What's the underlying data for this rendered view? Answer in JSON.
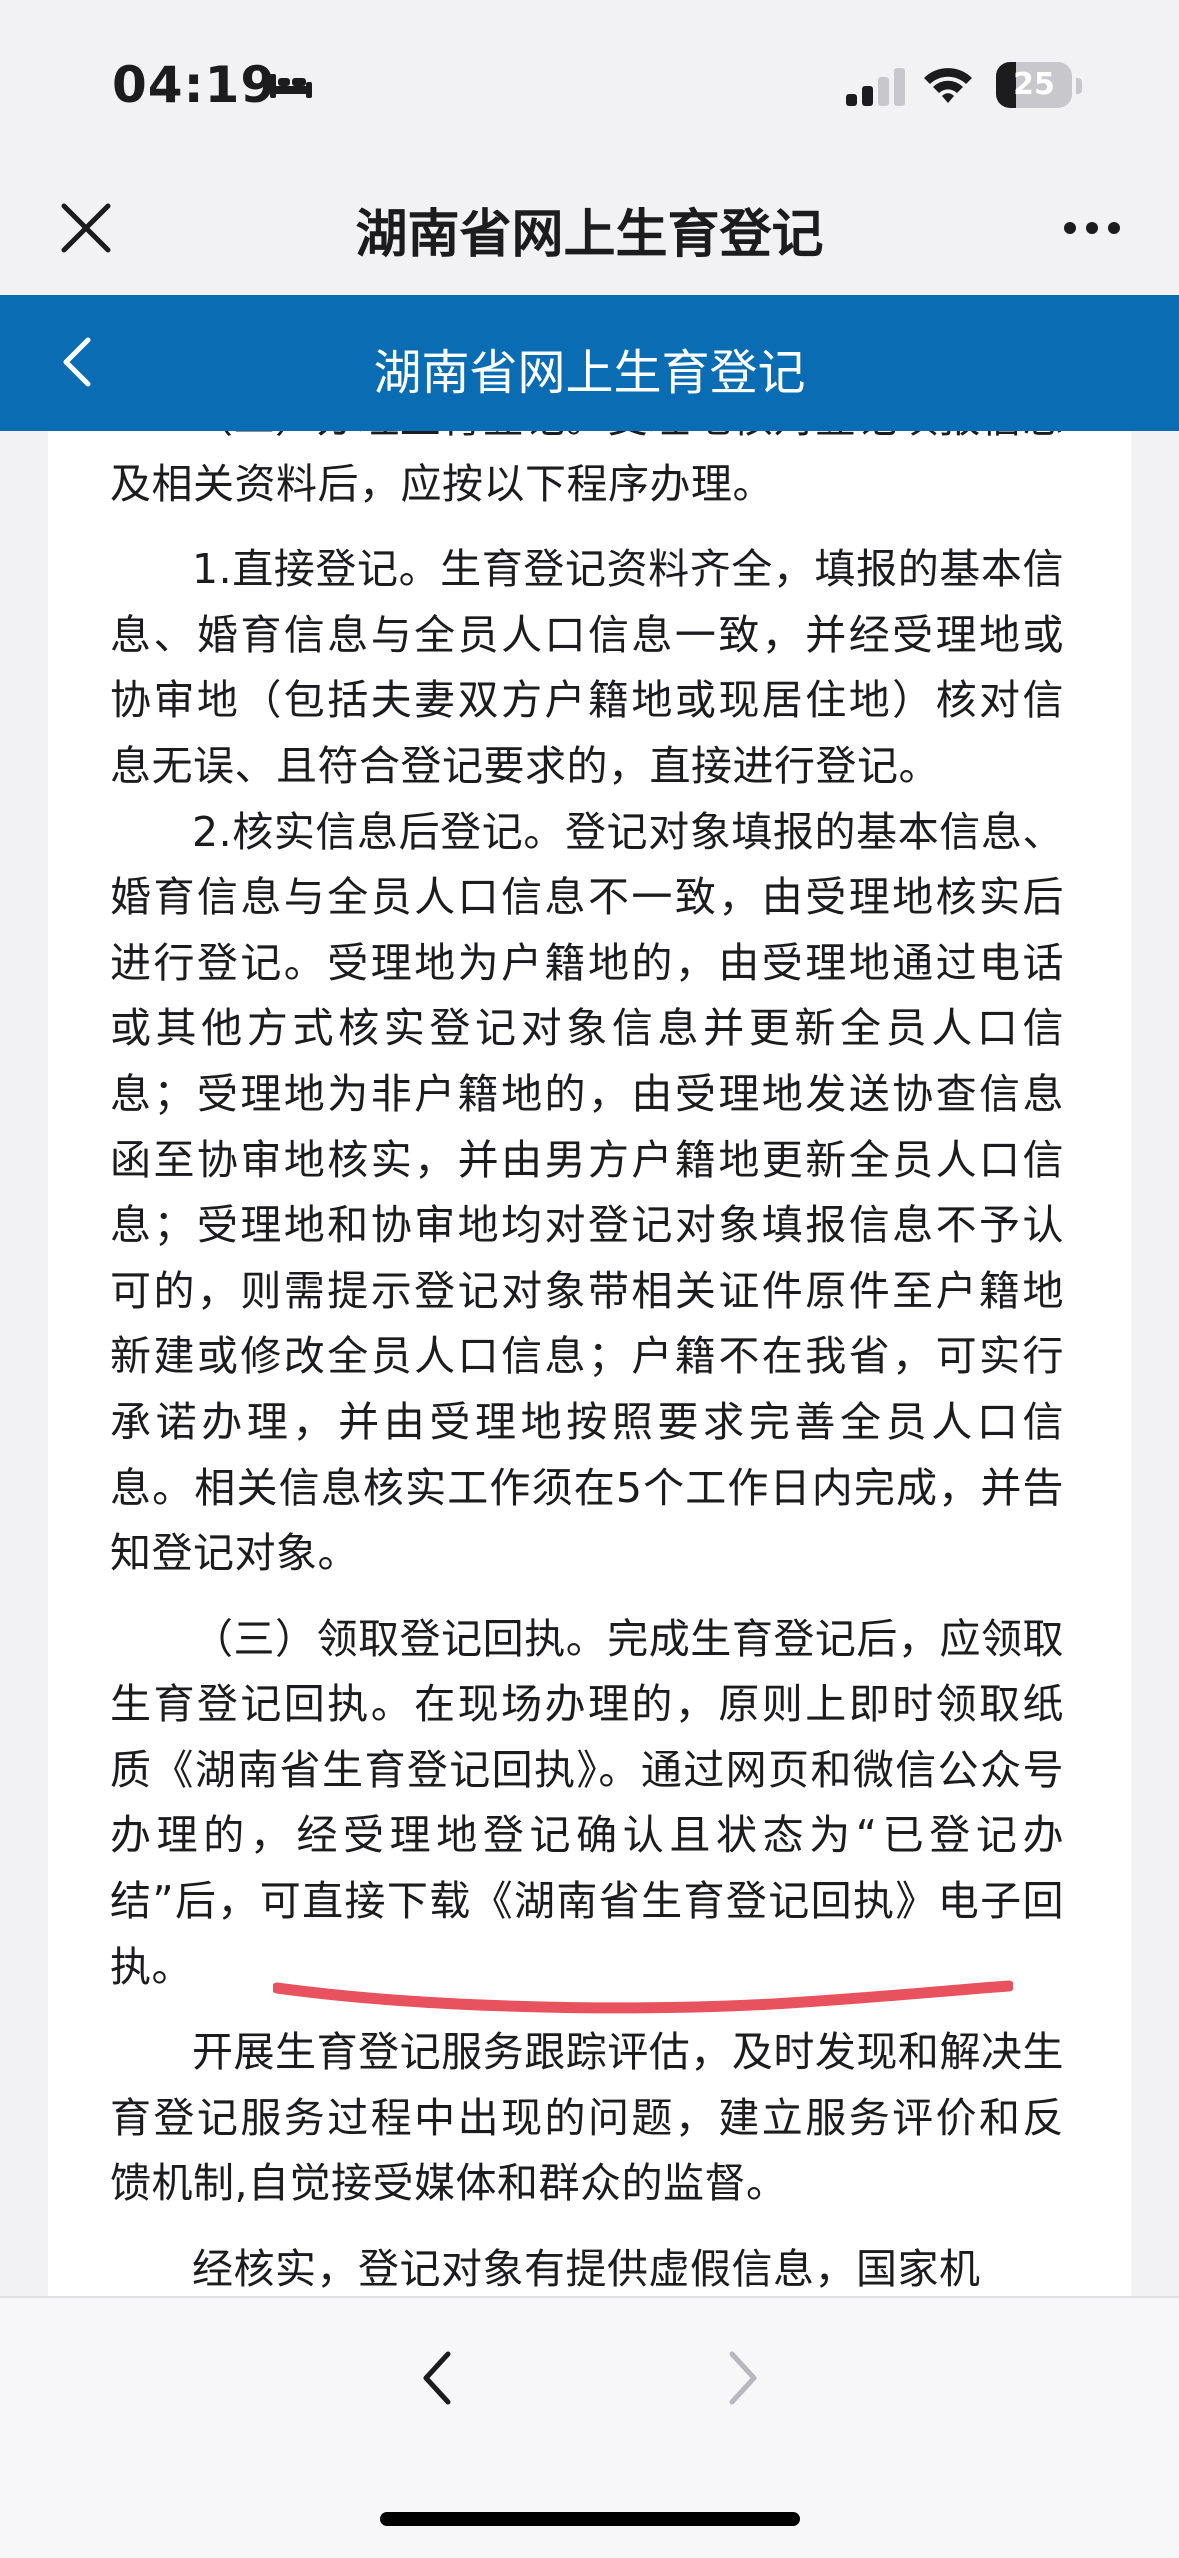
{
  "status_bar": {
    "time": "04:19",
    "battery_level": "25",
    "icons": [
      "bed-icon",
      "signal-icon",
      "wifi-icon",
      "battery-icon"
    ]
  },
  "browser": {
    "title": "湖南省网上生育登记",
    "icons": [
      "close-icon",
      "more-icon"
    ]
  },
  "page_header": {
    "title": "湖南省网上生育登记",
    "icons": [
      "back-icon"
    ],
    "background_color": "#0a6cb2"
  },
  "content": {
    "paragraphs": [
      "（二）办理生育登记。受理地核对登记填报信息及相关资料后，应按以下程序办理。",
      "1.直接登记。生育登记资料齐全，填报的基本信息、婚育信息与全员人口信息一致，并经受理地或协审地（包括夫妻双方户籍地或现居住地）核对信息无误、且符合登记要求的，直接进行登记。",
      "2.核实信息后登记。登记对象填报的基本信息、婚育信息与全员人口信息不一致，由受理地核实后进行登记。受理地为户籍地的，由受理地通过电话或其他方式核实登记对象信息并更新全员人口信息；受理地为非户籍地的，由受理地发送协查信息函至协审地核实，并由男方户籍地更新全员人口信息；受理地和协审地均对登记对象填报信息不予认可的，则需提示登记对象带相关证件原件至户籍地新建或修改全员人口信息；户籍不在我省，可实行承诺办理，并由受理地按照要求完善全员人口信息。相关信息核实工作须在5个工作日内完成，并告知登记对象。",
      "（三）领取登记回执。完成生育登记后，应领取生育登记回执。在现场办理的，原则上即时领取纸质《湖南省生育登记回执》。通过网页和微信公众号办理的，经受理地登记确认且状态为“已登记办结”后，可直接下载《湖南省生育登记回执》电子回执。",
      "开展生育登记服务跟踪评估，及时发现和解决生育登记服务过程中出现的问题，建立服务评价和反馈机制,自觉接受媒体和群众的监督。",
      "经核实，登记对象有提供虚假信息，国家机"
    ],
    "highlight_color": "#e8525e"
  },
  "bottom_toolbar": {
    "icons": [
      "nav-back-icon",
      "nav-forward-icon"
    ]
  }
}
